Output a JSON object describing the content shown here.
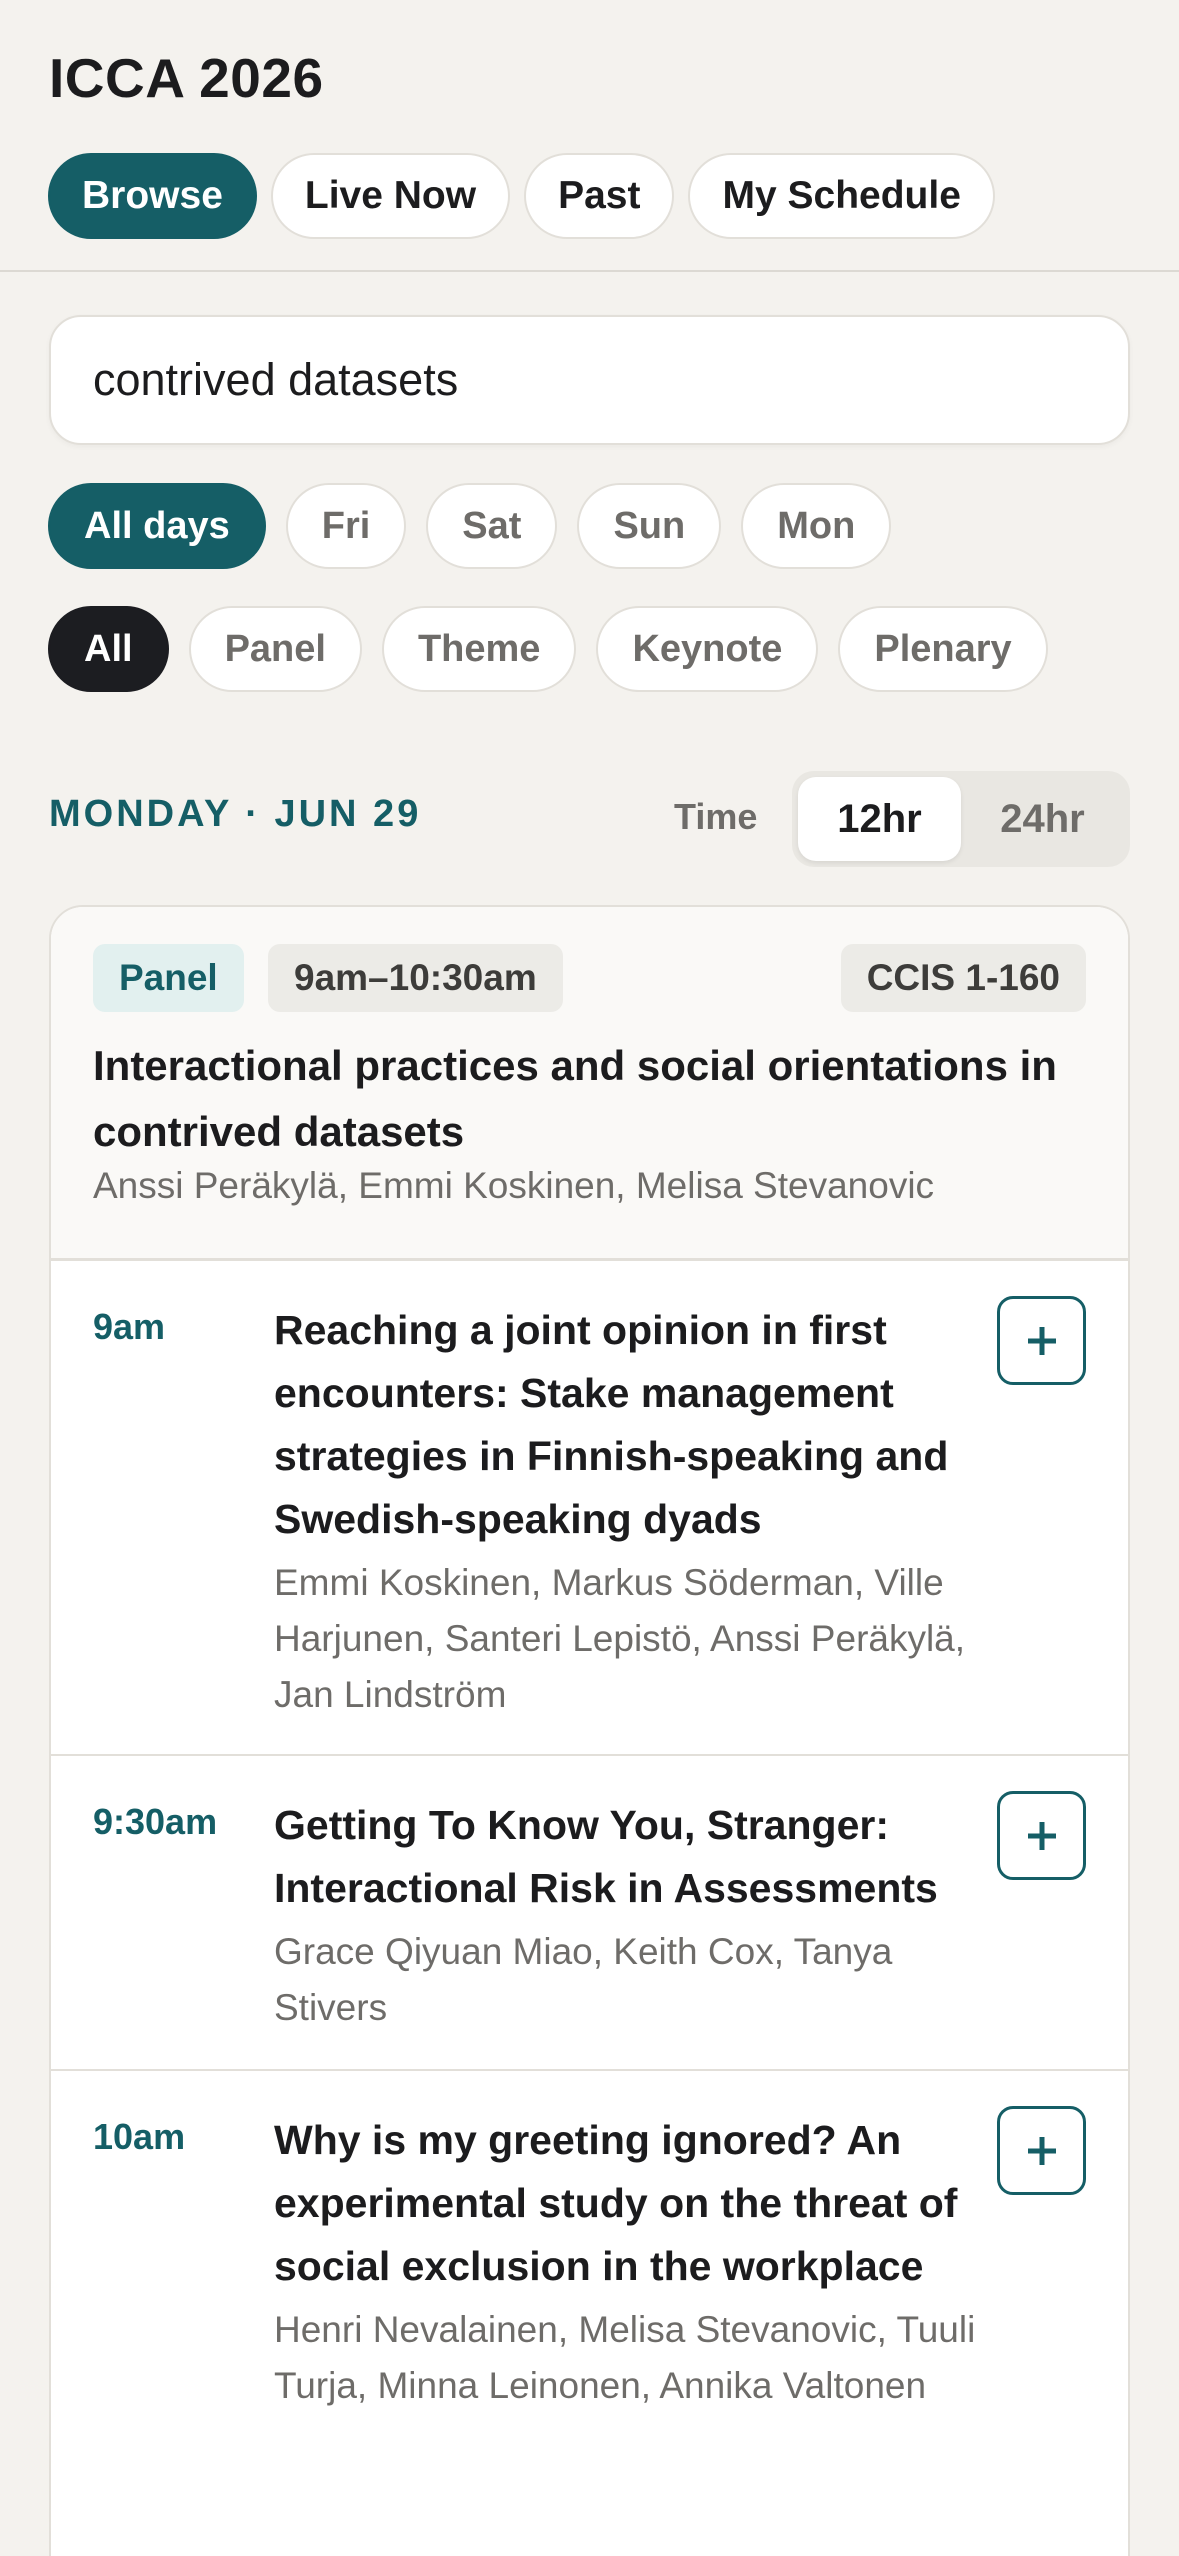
{
  "header": {
    "title": "ICCA 2026",
    "tabs": [
      {
        "label": "Browse",
        "active": true
      },
      {
        "label": "Live Now",
        "active": false
      },
      {
        "label": "Past",
        "active": false
      },
      {
        "label": "My Schedule",
        "active": false
      }
    ]
  },
  "search": {
    "value": "contrived datasets"
  },
  "filters": {
    "days": [
      "All days",
      "Fri",
      "Sat",
      "Sun",
      "Mon"
    ],
    "selected_day": "All days",
    "types": [
      "All",
      "Panel",
      "Theme",
      "Keynote",
      "Plenary"
    ],
    "selected_type": "All"
  },
  "schedule": {
    "day_label": "MONDAY · JUN 29",
    "time_label": "Time",
    "time_formats": [
      "12hr",
      "24hr"
    ],
    "selected_format": "12hr"
  },
  "session": {
    "type": "Panel",
    "time": "9am–10:30am",
    "room": "CCIS 1-160",
    "title": "Interactional practices and social orientations in contrived datasets",
    "authors": "Anssi Peräkylä, Emmi Koskinen, Melisa Stevanovic",
    "talks": [
      {
        "time": "9am",
        "title": "Reaching a joint opinion in first encounters: Stake management strategies in Finnish-speaking and Swedish-speaking dyads",
        "authors": "Emmi Koskinen, Markus Söderman, Ville Harjunen, Santeri Lepistö, Anssi Peräkylä, Jan Lindström"
      },
      {
        "time": "9:30am",
        "title": "Getting To Know You, Stranger: Interactional Risk in Assessments",
        "authors": "Grace Qiyuan Miao, Keith Cox, Tanya Stivers"
      },
      {
        "time": "10am",
        "title": "Why is my greeting ignored? An experimental study on the threat of social exclusion in the workplace",
        "authors": "Henri Nevalainen, Melisa Stevanovic, Tuuli Turja, Minna Leinonen, Annika Valtonen"
      }
    ]
  },
  "colors": {
    "accent": "#155e66",
    "dark_chip": "#1c1d21",
    "background": "#f4f2ee"
  },
  "icons": {
    "add": "plus-icon"
  }
}
